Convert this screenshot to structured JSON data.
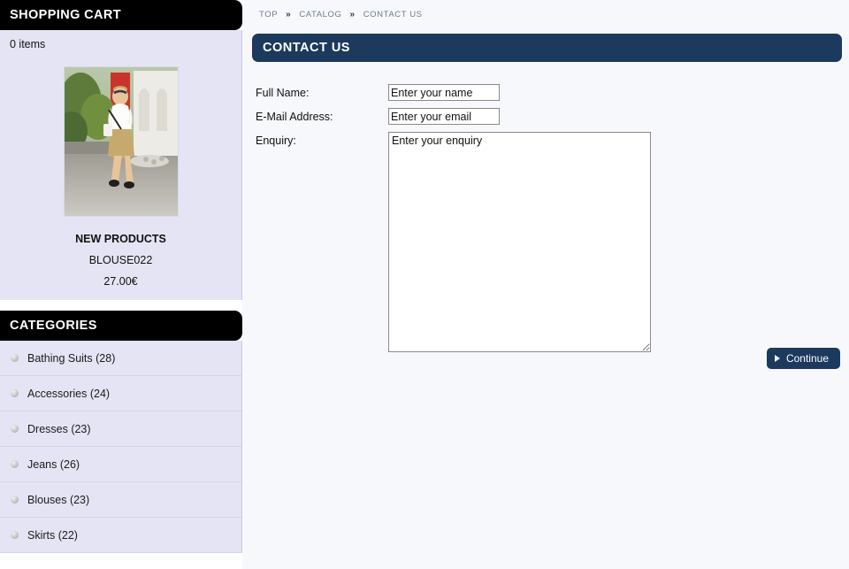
{
  "sidebar": {
    "cart": {
      "title": "SHOPPING CART",
      "items_text": "0 items"
    },
    "new_products": {
      "title": "NEW PRODUCTS",
      "product_name": "BLOUSE022",
      "price": "27.00€",
      "image_alt": "woman-in-white-blouse-and-tan-skirt-photo"
    },
    "categories": {
      "title": "CATEGORIES",
      "items": [
        {
          "label": "Bathing Suits (28)",
          "icon": "bullet-icon"
        },
        {
          "label": "Accessories (24)",
          "icon": "bullet-icon"
        },
        {
          "label": "Dresses (23)",
          "icon": "bullet-icon"
        },
        {
          "label": "Jeans (26)",
          "icon": "bullet-icon"
        },
        {
          "label": "Blouses (23)",
          "icon": "bullet-icon"
        },
        {
          "label": "Skirts (22)",
          "icon": "bullet-icon"
        }
      ]
    }
  },
  "main": {
    "breadcrumb": {
      "items": [
        "TOP",
        "CATALOG",
        "CONTACT US"
      ],
      "separator": "»"
    },
    "page_title": "CONTACT US",
    "form": {
      "full_name": {
        "label": "Full Name:",
        "value": "Enter your name",
        "placeholder": "Enter your name"
      },
      "email": {
        "label": "E-Mail Address:",
        "value": "Enter your email",
        "placeholder": "Enter your email"
      },
      "enquiry": {
        "label": "Enquiry:",
        "value": "Enter your enquiry",
        "placeholder": "Enter your enquiry"
      }
    },
    "continue_button": {
      "label": "Continue",
      "icon": "triangle-right-icon"
    }
  },
  "colors": {
    "navy": "#1b3a5e",
    "black_header": "#000000",
    "sidebar_bg": "#e4e4f4",
    "main_bg": "#f7f8fb"
  }
}
